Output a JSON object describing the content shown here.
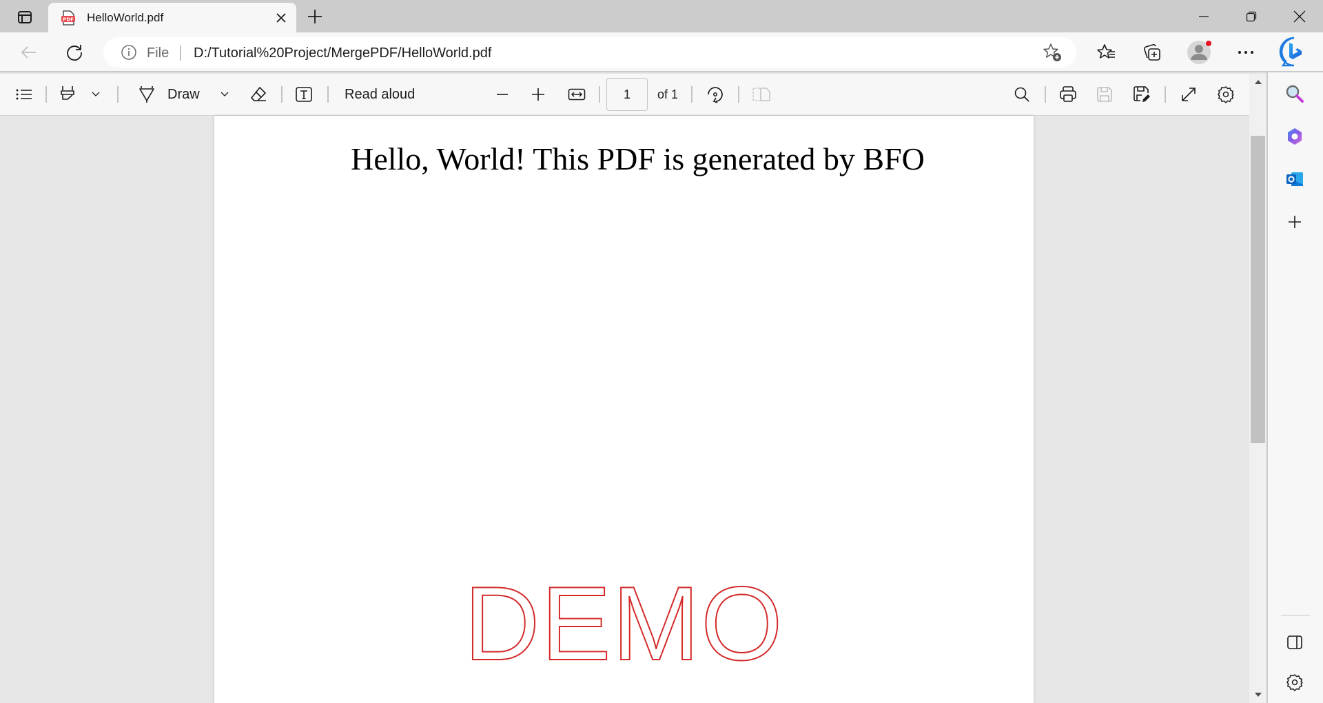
{
  "window": {
    "tab": {
      "title": "HelloWorld.pdf",
      "icon": "pdf-icon"
    },
    "controls": [
      "minimize-icon",
      "restore-icon",
      "close-icon"
    ]
  },
  "address_bar": {
    "scheme_label": "File",
    "url": "D:/Tutorial%20Project/MergePDF/HelloWorld.pdf"
  },
  "pdf_toolbar": {
    "draw_label": "Draw",
    "read_aloud_label": "Read aloud",
    "page_current": "1",
    "page_total_label": "of 1"
  },
  "document": {
    "headline": "Hello, World! This PDF is generated by BFO",
    "watermark": "DEMO",
    "watermark_color": "#d42a2a"
  },
  "sidebar": {
    "items": [
      "search-icon",
      "microsoft-365-icon",
      "outlook-icon",
      "add-icon"
    ],
    "bottom_items": [
      "hide-sidebar-icon",
      "settings-icon"
    ]
  },
  "colors": {
    "tabstrip": "#cccccc",
    "toolbar": "#f7f7f7",
    "viewer_bg": "#e6e6e6",
    "notification_dot": "#e81123"
  }
}
